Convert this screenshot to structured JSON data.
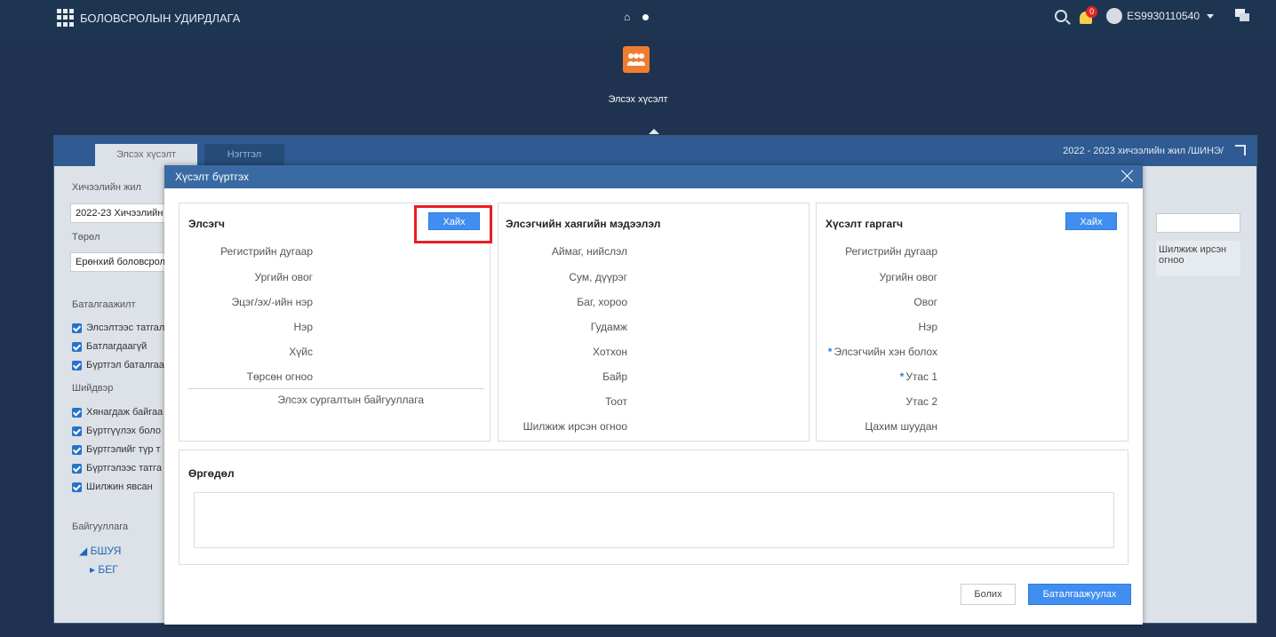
{
  "topbar": {
    "app_title": "БОЛОВСРОЛЫН УДИРДЛАГА",
    "notifications": "0",
    "user": "ES9930110540"
  },
  "hero": {
    "app_label": "Элсэх хүсэлт"
  },
  "bg": {
    "tab_active": "Элсэх хүсэлт",
    "tab_inactive": "Нэгтгэл",
    "year": "2022 - 2023 хичээлийн жил /ШИНЭ/",
    "school_year_label": "Хичээлийн жил",
    "school_year_value": "2022-23 Хичээлийн",
    "type_label": "Төрөл",
    "type_value": "Ерөнхий боловсрол",
    "confirm_label": "Баталгаажилт",
    "checks_confirm": [
      "Элсэлтээс татгал",
      "Батлагдаагүй",
      "Бүртгэл баталгаа"
    ],
    "decision_label": "Шийдвэр",
    "checks_decision": [
      "Хянагдаж байгаа",
      "Бүртгүүлэх боло",
      "Бүртгэлийг түр т",
      "Бүртгэлээс татга",
      "Шилжин явсан"
    ],
    "org_label": "Байгууллага",
    "tree_root": "БШУЯ",
    "tree_child": "БЕГ",
    "right_col_header": "Шилжиж ирсэн огноо"
  },
  "modal": {
    "title": "Хүсэлт бүртгэх",
    "applicant": {
      "title": "Элсэгч",
      "search_label": "Хайх",
      "fields": [
        "Регистрийн дугаар",
        "Ургийн овог",
        "Эцэг/эх/-ийн нэр",
        "Нэр",
        "Хүйс",
        "Төрсөн огноо"
      ],
      "org_field": "Элсэх сургалтын байгууллага"
    },
    "address": {
      "title": "Элсэгчийн хаягийн мэдээлэл",
      "fields": [
        "Аймаг, нийслэл",
        "Сум, дүүрэг",
        "Баг, хороо",
        "Гудамж",
        "Хотхон",
        "Байр",
        "Тоот",
        "Шилжиж ирсэн огноо"
      ]
    },
    "requester": {
      "title": "Хүсэлт гаргагч",
      "search_label": "Хайх",
      "fields": [
        "Регистрийн дугаар",
        "Ургийн овог",
        "Овог",
        "Нэр",
        "Элсэгчийн хэн болох",
        "Утас 1",
        "Утас 2",
        "Цахим шуудан"
      ]
    },
    "application": {
      "title": "Өргөдөл"
    },
    "cancel_label": "Болих",
    "confirm_label": "Баталгаажуулах"
  }
}
